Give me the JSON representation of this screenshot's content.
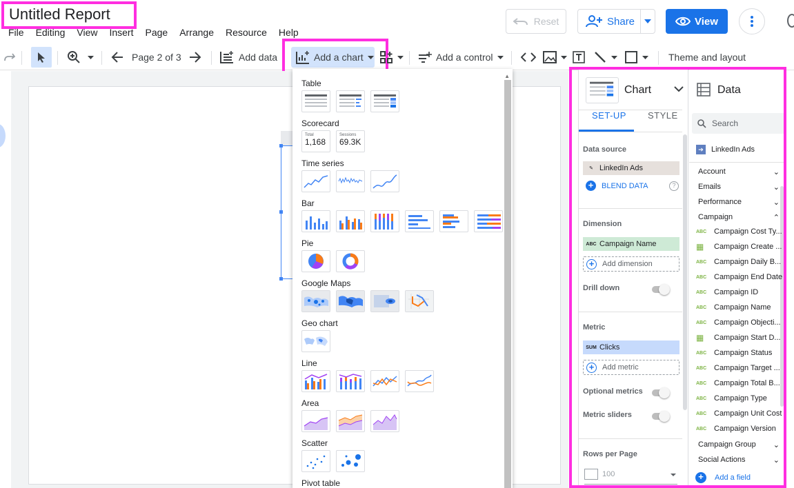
{
  "header": {
    "title": "Untitled Report",
    "menu": [
      "File",
      "Editing",
      "View",
      "Insert",
      "Page",
      "Arrange",
      "Resource",
      "Help"
    ],
    "reset_label": "Reset",
    "share_label": "Share",
    "view_label": "View"
  },
  "toolbar": {
    "page_label": "Page 2 of 3",
    "add_data": "Add data",
    "add_chart": "Add a chart",
    "add_control": "Add a control",
    "theme_layout": "Theme and layout"
  },
  "chart_menu": {
    "sections": [
      "Table",
      "Scorecard",
      "Time series",
      "Bar",
      "Pie",
      "Google Maps",
      "Geo chart",
      "Line",
      "Area",
      "Scatter",
      "Pivot table"
    ],
    "scorecard_1": {
      "label": "Total",
      "value": "1,168"
    },
    "scorecard_2": {
      "label": "Sessions",
      "value": "69.3K"
    }
  },
  "chart_panel": {
    "title": "Chart",
    "tab_setup": "SET-UP",
    "tab_style": "STYLE",
    "data_source_label": "Data source",
    "data_source_value": "LinkedIn Ads",
    "blend_data": "BLEND DATA",
    "dimension_label": "Dimension",
    "dimension_tag": "ABC",
    "dimension_value": "Campaign Name",
    "add_dimension": "Add dimension",
    "drill_down": "Drill down",
    "metric_label": "Metric",
    "metric_tag": "SUM",
    "metric_value": "Clicks",
    "add_metric": "Add metric",
    "optional_metrics": "Optional metrics",
    "metric_sliders": "Metric sliders",
    "rows_per_page": "Rows per Page",
    "rows_value": "100"
  },
  "data_panel": {
    "title": "Data",
    "search_placeholder": "Search",
    "source": "LinkedIn Ads",
    "groups_top": [
      "Account",
      "Emails",
      "Performance",
      "Campaign"
    ],
    "fields": [
      {
        "type": "ABC",
        "name": "Campaign Cost Ty..."
      },
      {
        "type": "date",
        "name": "Campaign Create ..."
      },
      {
        "type": "ABC",
        "name": "Campaign Daily B..."
      },
      {
        "type": "ABC",
        "name": "Campaign End Date"
      },
      {
        "type": "ABC",
        "name": "Campaign ID"
      },
      {
        "type": "ABC",
        "name": "Campaign Name"
      },
      {
        "type": "ABC",
        "name": "Campaign Objecti..."
      },
      {
        "type": "date",
        "name": "Campaign Start D..."
      },
      {
        "type": "ABC",
        "name": "Campaign Status"
      },
      {
        "type": "ABC",
        "name": "Campaign Target ..."
      },
      {
        "type": "ABC",
        "name": "Campaign Total B..."
      },
      {
        "type": "ABC",
        "name": "Campaign Type"
      },
      {
        "type": "ABC",
        "name": "Campaign Unit Cost"
      },
      {
        "type": "ABC",
        "name": "Campaign Version"
      }
    ],
    "groups_bottom": [
      "Campaign Group",
      "Social Actions"
    ],
    "add_field": "Add a field"
  },
  "colors": {
    "accent": "#1a73e8",
    "highlight": "#ff2ee0"
  }
}
